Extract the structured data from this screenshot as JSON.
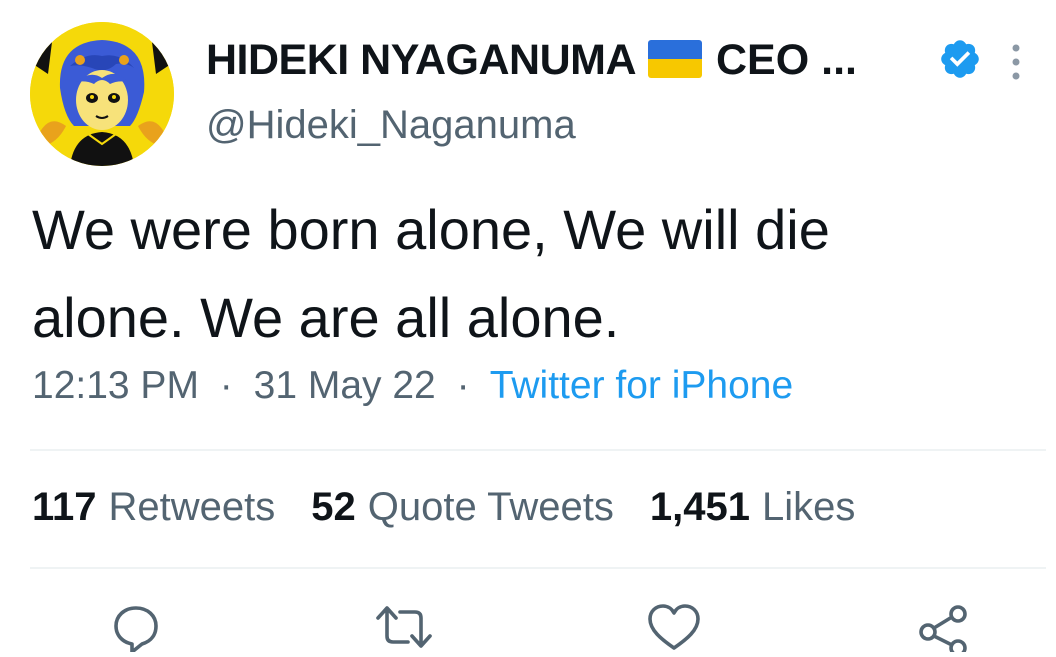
{
  "author": {
    "display_name": "HIDEKI NYAGANUMA",
    "name_suffix": "CEO ...",
    "flag_icon": "ukraine-flag",
    "verified_icon": "verified-badge-icon",
    "handle": "@Hideki_Naganuma"
  },
  "tweet": {
    "text_line1": "We were born alone, We will die",
    "text_line2": "alone. We are all alone."
  },
  "meta": {
    "time": "12:13 PM",
    "separator": "·",
    "date": "31 May 22",
    "source": "Twitter for iPhone"
  },
  "stats": {
    "retweets_count": "117",
    "retweets_label": "Retweets",
    "quotes_count": "52",
    "quotes_label": "Quote Tweets",
    "likes_count": "1,451",
    "likes_label": "Likes"
  },
  "actions": [
    "reply-icon",
    "retweet-icon",
    "like-icon",
    "share-icon"
  ],
  "colors": {
    "text": "#0f1419",
    "secondary": "#536471",
    "link": "#1d9bf0",
    "divider": "#eff3f4"
  }
}
